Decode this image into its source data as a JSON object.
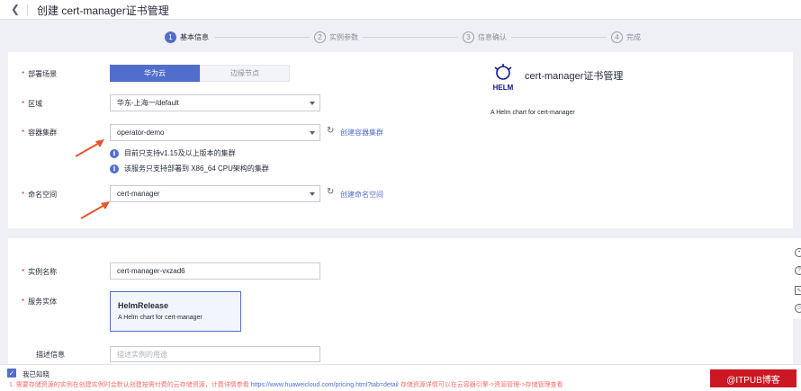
{
  "header": {
    "back_icon": "chevron-left-icon",
    "title": "创建 cert-manager证书管理"
  },
  "steps": [
    {
      "num": "1",
      "label": "基本信息",
      "active": true
    },
    {
      "num": "2",
      "label": "实例参数",
      "active": false
    },
    {
      "num": "3",
      "label": "信息确认",
      "active": false
    },
    {
      "num": "4",
      "label": "完成",
      "active": false
    }
  ],
  "form": {
    "scene": {
      "label": "部署场景",
      "options": [
        "华为云",
        "边缘节点"
      ],
      "selected": "华为云"
    },
    "region": {
      "label": "区域",
      "value": "华东-上海一/default"
    },
    "cluster": {
      "label": "容器集群",
      "value": "operator-demo",
      "create_link": "创建容器集群",
      "notes": [
        "目前只支持v1.15及以上版本的集群",
        "该服务只支持部署到 X86_64 CPU架构的集群"
      ]
    },
    "namespace": {
      "label": "命名空间",
      "value": "cert-manager",
      "create_link": "创建命名空间"
    },
    "instance_name": {
      "label": "实例名称",
      "value": "cert-manager-vxzad6"
    },
    "service_entity": {
      "label": "服务实体",
      "card_title": "HelmRelease",
      "card_desc": "A Helm chart for cert-manager"
    },
    "description": {
      "label": "描述信息",
      "placeholder": "描述实例的用途"
    }
  },
  "chart_info": {
    "logo_text": "HELM",
    "title": "cert-manager证书管理",
    "desc": "A Helm chart for cert-manager"
  },
  "footer": {
    "agree_label": "我已知晓",
    "notice_prefix": "1. 需要存储资源的实例在创建实例时会默认创建按需付费的云存储资源，计费详情参看 ",
    "notice_url": "https://www.huaweicloud.com/pricing.html?tab=detail",
    "notice_suffix": " 存储资源详情可以在云容器引擎->资源管理->存储管理查看"
  },
  "watermark": "@ITPUB博客",
  "colors": {
    "primary": "#526ecc",
    "required": "#e5242b",
    "arrow": "#e4572e",
    "notice": "#f66f6a"
  }
}
